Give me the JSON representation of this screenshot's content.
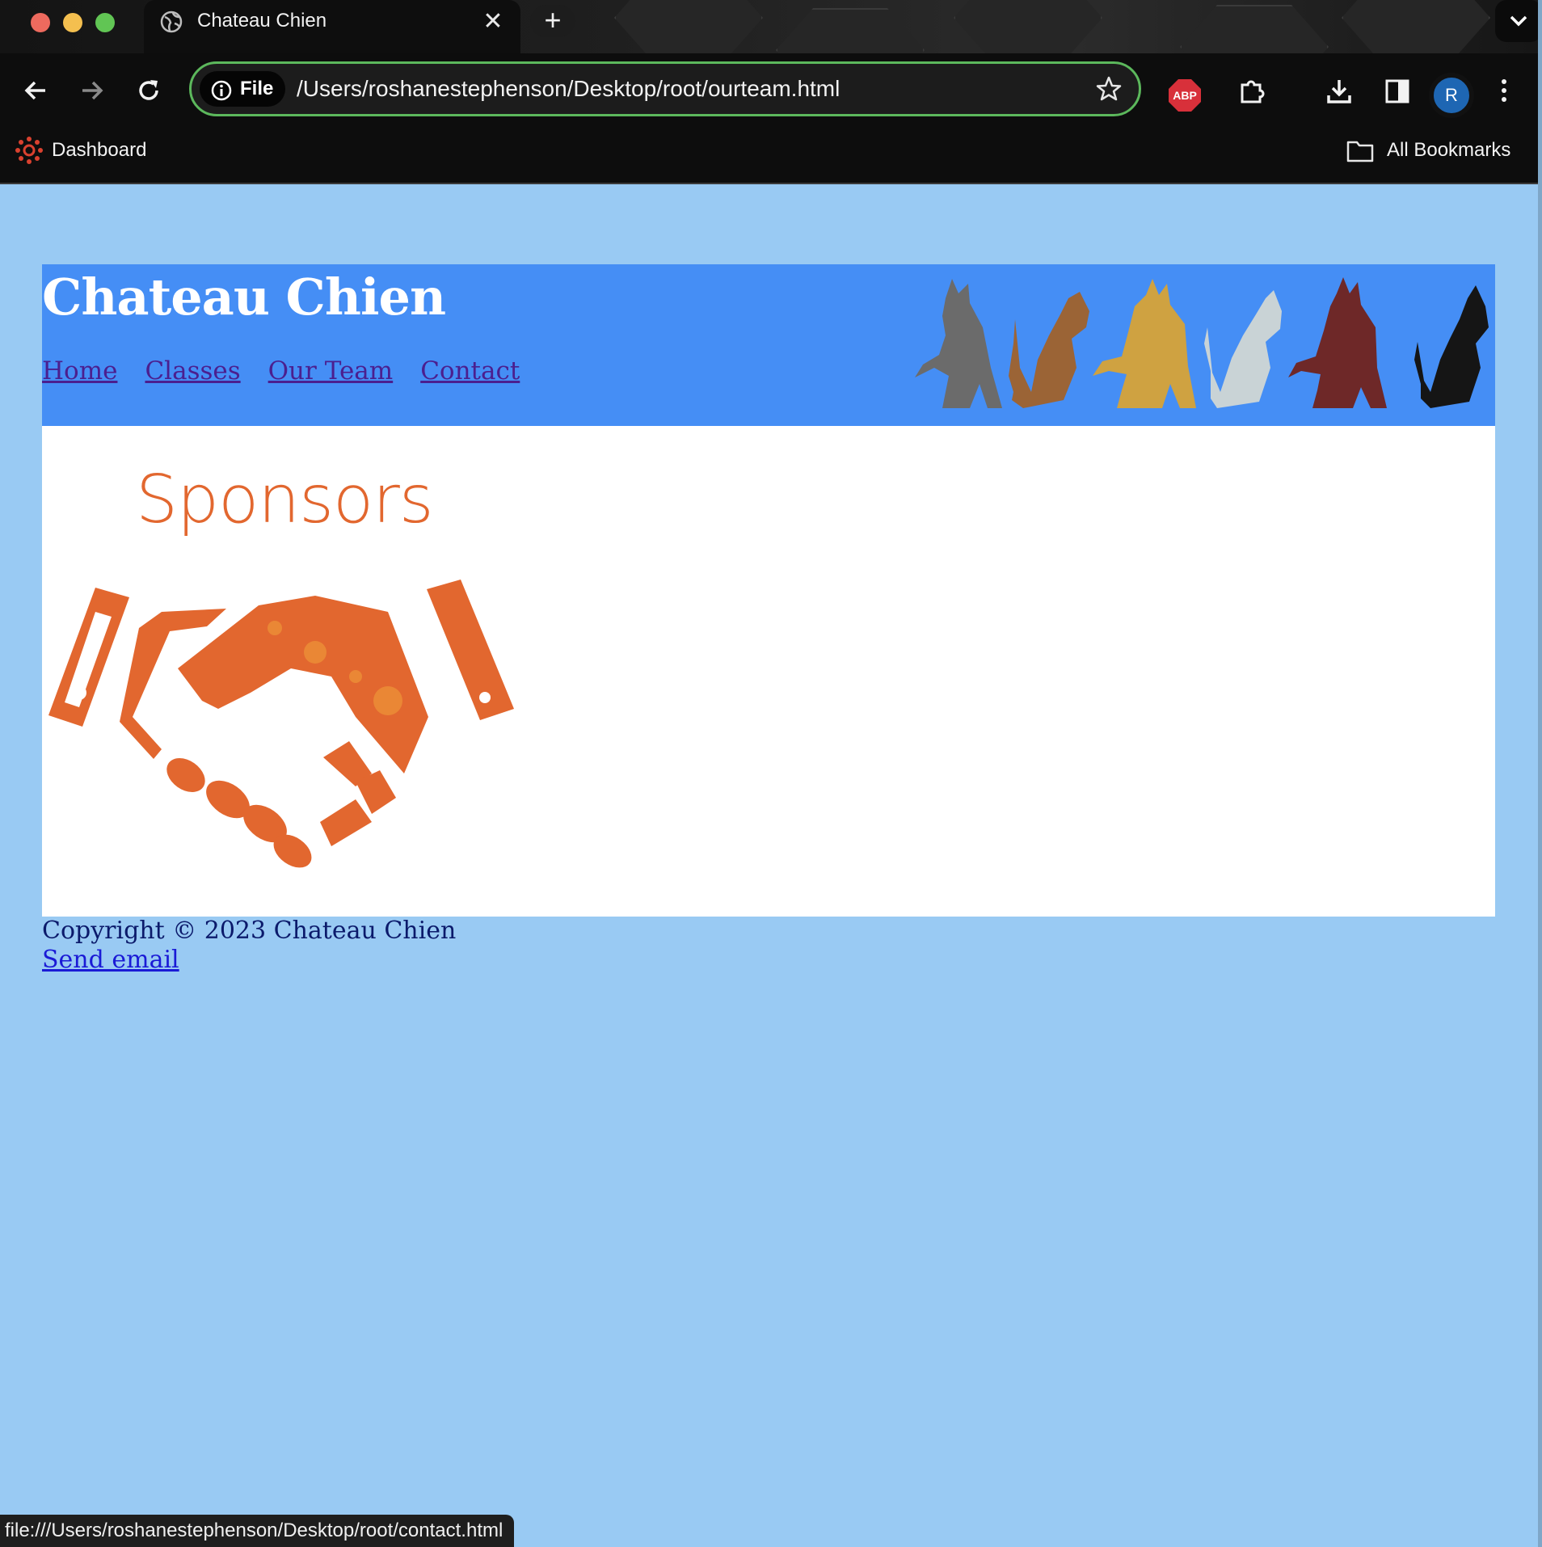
{
  "browser": {
    "tab_title": "Chateau Chien",
    "new_tab_symbol": "+",
    "close_symbol": "✕",
    "omnibox": {
      "chip_label": "File",
      "url": "/Users/roshanestephenson/Desktop/root/ourteam.html"
    },
    "extension_abp": "ABP",
    "profile_initial": "R",
    "bookmarks": {
      "dashboard": "Dashboard",
      "all_bookmarks": "All Bookmarks"
    },
    "status_url": "file:///Users/roshanestephenson/Desktop/root/contact.html",
    "icons": [
      "globe-icon",
      "back-icon",
      "forward-icon",
      "reload-icon",
      "info-icon",
      "star-icon",
      "extensions-icon",
      "download-icon",
      "sidepanel-icon",
      "menu-icon",
      "folder-icon",
      "canvas-icon"
    ]
  },
  "site": {
    "title": "Chateau Chien",
    "nav": [
      "Home",
      "Classes",
      "Our Team",
      "Contact"
    ],
    "sponsors_heading": "Sponsors",
    "footer": {
      "copyright": "Copyright © 2023 Chateau Chien",
      "email_link": "Send email"
    },
    "colors": {
      "page_bg": "#99caf3",
      "header_bg": "#458ef5",
      "nav_link": "#4b1f8f",
      "accent_orange": "#e2672f"
    }
  }
}
